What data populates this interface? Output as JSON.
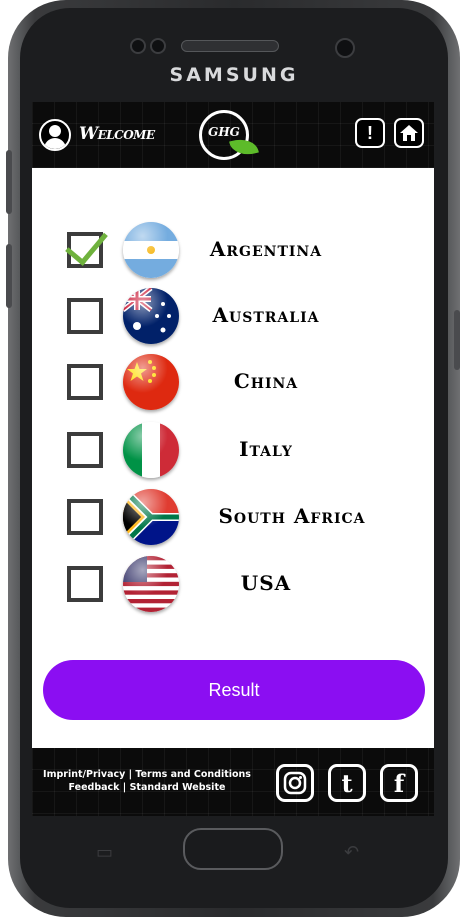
{
  "device": {
    "brand": "SAMSUNG"
  },
  "header": {
    "welcome": "Welcome",
    "logo_text": "GHG",
    "info_icon": "!",
    "home_icon": "home-icon"
  },
  "countries": [
    {
      "name": "Argentina",
      "checked": true
    },
    {
      "name": "Australia",
      "checked": false
    },
    {
      "name": "China",
      "checked": false
    },
    {
      "name": "Italy",
      "checked": false
    },
    {
      "name": "South Africa",
      "checked": false
    },
    {
      "name": "USA",
      "checked": false
    }
  ],
  "result_button": {
    "label": "Result",
    "color": "#8b0ef2"
  },
  "footer": {
    "line1": "Imprint/Privacy | Terms and Conditions",
    "line2": "Feedback | Standard Website",
    "social": [
      "instagram-icon",
      "tumblr-icon",
      "facebook-icon"
    ]
  }
}
